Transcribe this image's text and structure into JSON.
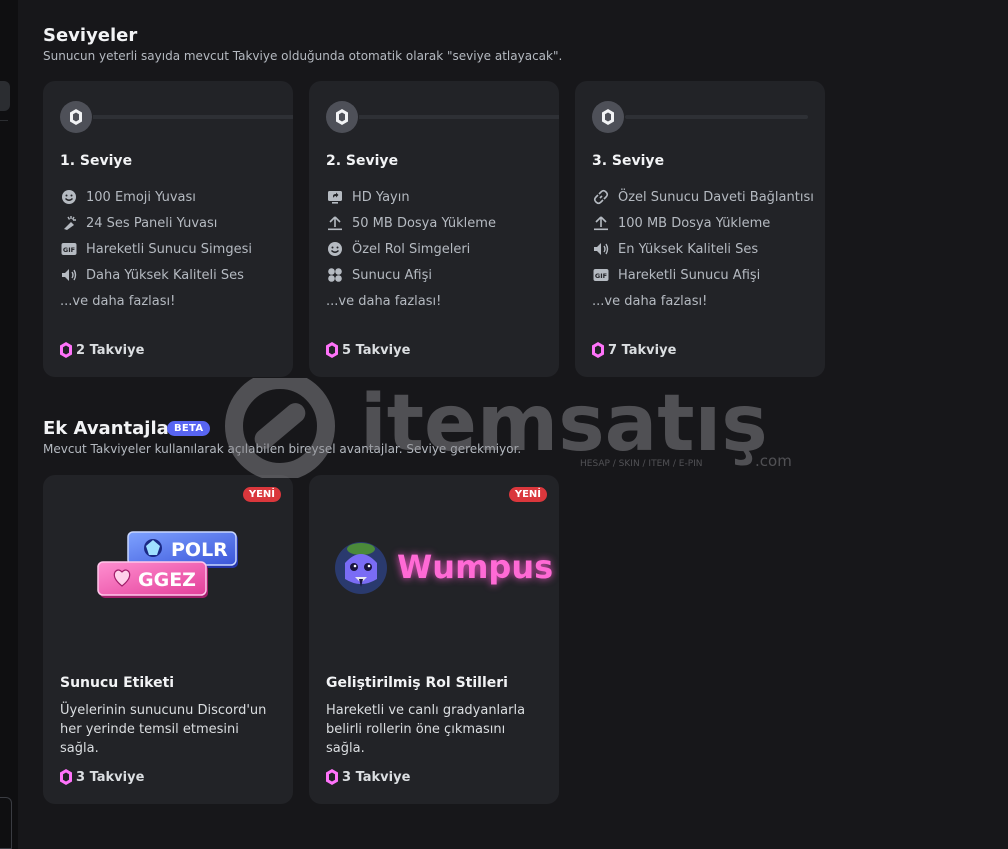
{
  "levels": {
    "title": "Seviyeler",
    "subtitle": "Sunucun yeterli sayıda mevcut Takviye olduğunda otomatik olarak \"seviye atlayacak\".",
    "tiers": [
      {
        "name": "1. Seviye",
        "perks": [
          {
            "icon": "emoji-icon",
            "label": "100 Emoji Yuvası"
          },
          {
            "icon": "soundboard-icon",
            "label": "24 Ses Paneli Yuvası"
          },
          {
            "icon": "gif-icon",
            "label": "Hareketli Sunucu Simgesi"
          },
          {
            "icon": "speaker-icon",
            "label": "Daha Yüksek Kaliteli Ses"
          }
        ],
        "more": "...ve daha fazlası!",
        "cost": "2 Takviye"
      },
      {
        "name": "2. Seviye",
        "perks": [
          {
            "icon": "screen-share-icon",
            "label": "HD Yayın"
          },
          {
            "icon": "upload-icon",
            "label": "50 MB Dosya Yükleme"
          },
          {
            "icon": "emoji-icon",
            "label": "Özel Rol Simgeleri"
          },
          {
            "icon": "grid-icon",
            "label": "Sunucu Afişi"
          }
        ],
        "more": "...ve daha fazlası!",
        "cost": "5 Takviye"
      },
      {
        "name": "3. Seviye",
        "perks": [
          {
            "icon": "link-icon",
            "label": "Özel Sunucu Daveti Bağlantısı"
          },
          {
            "icon": "upload-icon",
            "label": "100 MB Dosya Yükleme"
          },
          {
            "icon": "speaker-icon",
            "label": "En Yüksek Kaliteli Ses"
          },
          {
            "icon": "gif-icon",
            "label": "Hareketli Sunucu Afişi"
          }
        ],
        "more": "...ve daha fazlası!",
        "cost": "7 Takviye"
      }
    ]
  },
  "extras": {
    "title": "Ek Avantajlar",
    "beta_badge": "BETA",
    "subtitle": "Mevcut Takviyeler kullanılarak açılabilen bireysel avantajlar. Seviye gerekmiyor.",
    "cards": [
      {
        "badge": "YENİ",
        "tags": [
          "POLR",
          "GGEZ"
        ],
        "title": "Sunucu Etiketi",
        "description": "Üyelerinin sunucunu Discord'un her yerinde temsil etmesini sağla.",
        "cost": "3 Takviye"
      },
      {
        "badge": "YENİ",
        "preview_name": "Wumpus",
        "title": "Geliştirilmiş Rol Stilleri",
        "description": "Hareketli ve canlı gradyanlarla belirli rollerin öne çıkmasını sağla.",
        "cost": "3 Takviye"
      }
    ]
  },
  "watermark": {
    "brand": "itemsatış",
    "tagline": "HESAP / SKIN / ITEM / E-PIN",
    "suffix": ".com"
  },
  "colors": {
    "background": "#17171a",
    "card": "#222327",
    "boost_pink": "#ff73fa",
    "new_red": "#da373c",
    "beta_blurple": "#5865f2"
  }
}
